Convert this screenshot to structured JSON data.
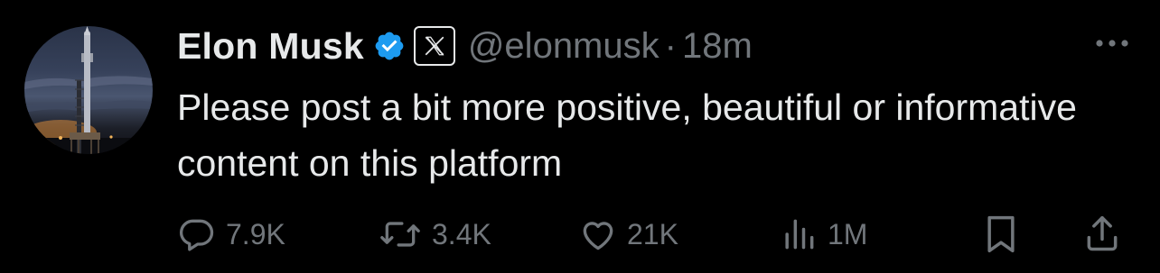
{
  "tweet": {
    "author": {
      "display_name": "Elon Musk",
      "handle": "@elonmusk",
      "verified_icon": "verified-badge-icon",
      "affiliation_icon": "x-logo-icon"
    },
    "separator": "·",
    "timestamp": "18m",
    "text": "Please post a bit more positive, beautiful or informative content on this platform",
    "actions": {
      "replies": "7.9K",
      "reposts": "3.4K",
      "likes": "21K",
      "views": "1M"
    }
  },
  "colors": {
    "background": "#000000",
    "primary_text": "#e7e9ea",
    "secondary_text": "#71767b",
    "verified_blue": "#1d9bf0"
  }
}
